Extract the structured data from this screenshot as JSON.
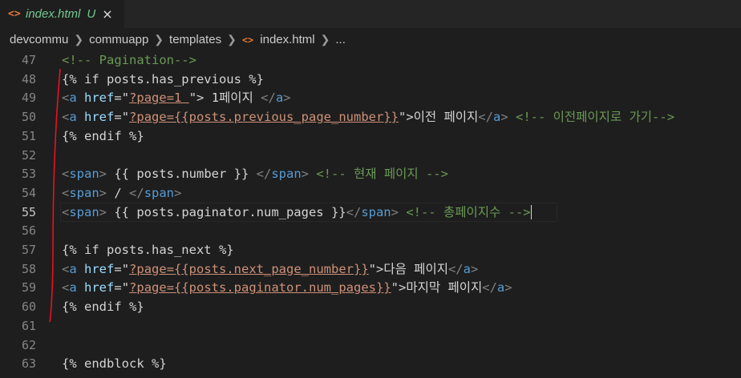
{
  "tab": {
    "icon": "<>",
    "name": "index.html",
    "status": "U",
    "close": "×"
  },
  "breadcrumb": {
    "items": [
      "devcommu",
      "commuapp",
      "templates",
      "index.html",
      "..."
    ]
  },
  "editor": {
    "active_line": 55,
    "line_numbers": [
      "47",
      "48",
      "49",
      "50",
      "51",
      "52",
      "53",
      "54",
      "55",
      "56",
      "57",
      "58",
      "59",
      "60",
      "61",
      "62",
      "63"
    ],
    "code": [
      {
        "c": "<!-- Pagination-->"
      },
      {
        "a": "{% if posts.has_previous %}"
      },
      {
        "a": "<",
        "b": "a",
        "c": " href",
        "d": "=\"",
        "e": "?page=1 ",
        "f": "\"",
        "g": "> 1페이지 ",
        "h": "</",
        "i": "a",
        "j": ">"
      },
      {
        "a": "<",
        "b": "a",
        "c": " href",
        "d": "=\"",
        "e": "?page={{posts.previous_page_number}}",
        "f": "\"",
        "g": ">이전 페이지",
        "h": "</",
        "i": "a",
        "j": ">",
        "k": " <!-- 이전페이지로 가기-->"
      },
      {
        "a": "{% endif %}"
      },
      {},
      {
        "a": "<",
        "b": "span",
        "c": ">",
        "d": " {{ posts.number }} ",
        "e": "</",
        "f": "span",
        "g": ">",
        "h": " <!-- 현재 페이지 -->"
      },
      {
        "a": "<",
        "b": "span",
        "c": ">",
        "d": " / ",
        "e": "</",
        "f": "span",
        "g": ">"
      },
      {
        "a": "<",
        "b": "span",
        "c": ">",
        "d": " {{ posts.paginator.num_pages }}",
        "e": "</",
        "f": "span",
        "g": ">",
        "h": " <!-- 총페이지수 -->"
      },
      {},
      {
        "a": "{% if posts.has_next %}"
      },
      {
        "a": "<",
        "b": "a",
        "c": " href",
        "d": "=\"",
        "e": "?page={{posts.next_page_number}}",
        "f": "\"",
        "g": ">다음 페이지",
        "h": "</",
        "i": "a",
        "j": ">"
      },
      {
        "a": "<",
        "b": "a",
        "c": " href",
        "d": "=\"",
        "e": "?page={{posts.paginator.num_pages}}",
        "f": "\"",
        "g": ">마지막 페이지",
        "h": "</",
        "i": "a",
        "j": ">"
      },
      {
        "a": "{% endif %}"
      },
      {},
      {},
      {
        "a": "{% endblock %}"
      }
    ]
  },
  "colors": {
    "background": "#1e1e1e",
    "tag_name": "#569cd6",
    "attribute": "#9cdcfe",
    "string": "#ce9178",
    "comment": "#6a9955",
    "annotation": "#e81123"
  }
}
